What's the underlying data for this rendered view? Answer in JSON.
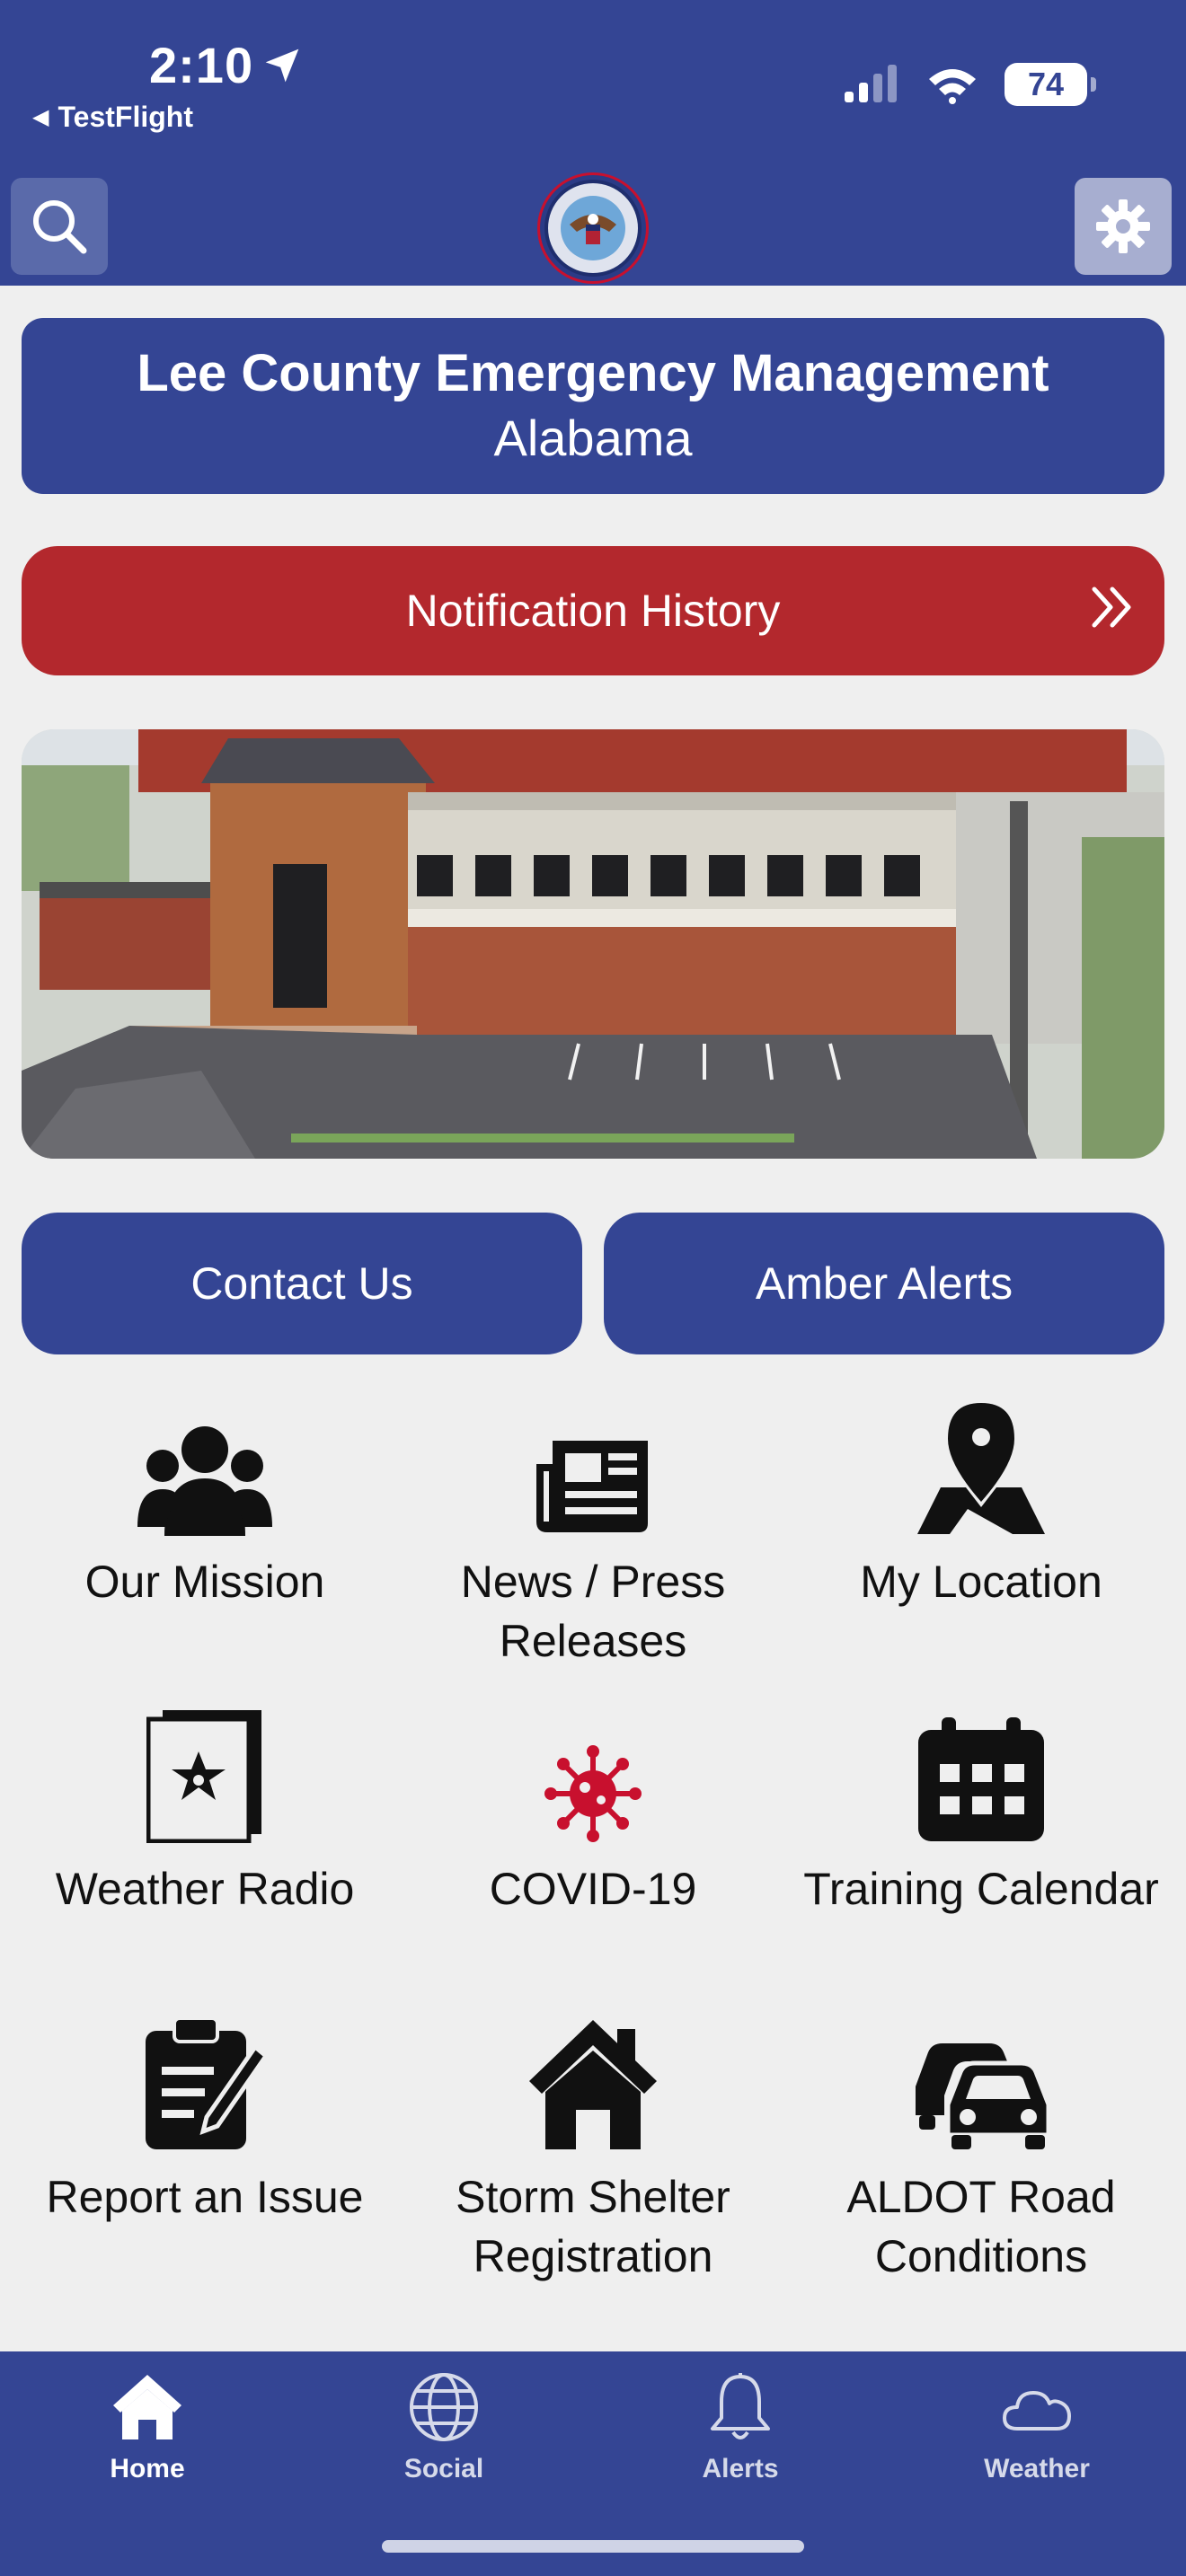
{
  "status_bar": {
    "time": "2:10",
    "back_app": "TestFlight",
    "battery": "74"
  },
  "header": {
    "search_icon": "search-icon",
    "settings_icon": "gear-icon",
    "logo": "lee-county-ema-seal"
  },
  "title_card": {
    "line1": "Lee County Emergency Management",
    "line2": "Alabama"
  },
  "notification_history": {
    "label": "Notification History",
    "icon": "double-chevron-right-icon"
  },
  "photo": "ema-building-aerial-photo",
  "buttons": {
    "contact": "Contact Us",
    "amber": "Amber Alerts"
  },
  "grid": [
    {
      "label": "Our Mission",
      "icon": "people-group-icon"
    },
    {
      "label": "News / Press Releases",
      "icon": "newspaper-icon"
    },
    {
      "label": "My Location",
      "icon": "map-pin-icon"
    },
    {
      "label": "Weather Radio",
      "icon": "sheriff-star-book-icon"
    },
    {
      "label": "COVID-19",
      "icon": "virus-icon",
      "color": "#c8102e"
    },
    {
      "label": "Training Calendar",
      "icon": "calendar-icon"
    },
    {
      "label": "Report an Issue",
      "icon": "clipboard-edit-icon"
    },
    {
      "label": "Storm Shelter Registration",
      "icon": "house-icon"
    },
    {
      "label": "ALDOT Road Conditions",
      "icon": "cars-icon"
    }
  ],
  "tabs": [
    {
      "label": "Home",
      "icon": "home-icon",
      "active": true
    },
    {
      "label": "Social",
      "icon": "globe-icon"
    },
    {
      "label": "Alerts",
      "icon": "bell-icon"
    },
    {
      "label": "Weather",
      "icon": "cloud-icon"
    }
  ],
  "colors": {
    "primary": "#344594",
    "accent_red": "#b3282d",
    "background": "#efefef"
  }
}
